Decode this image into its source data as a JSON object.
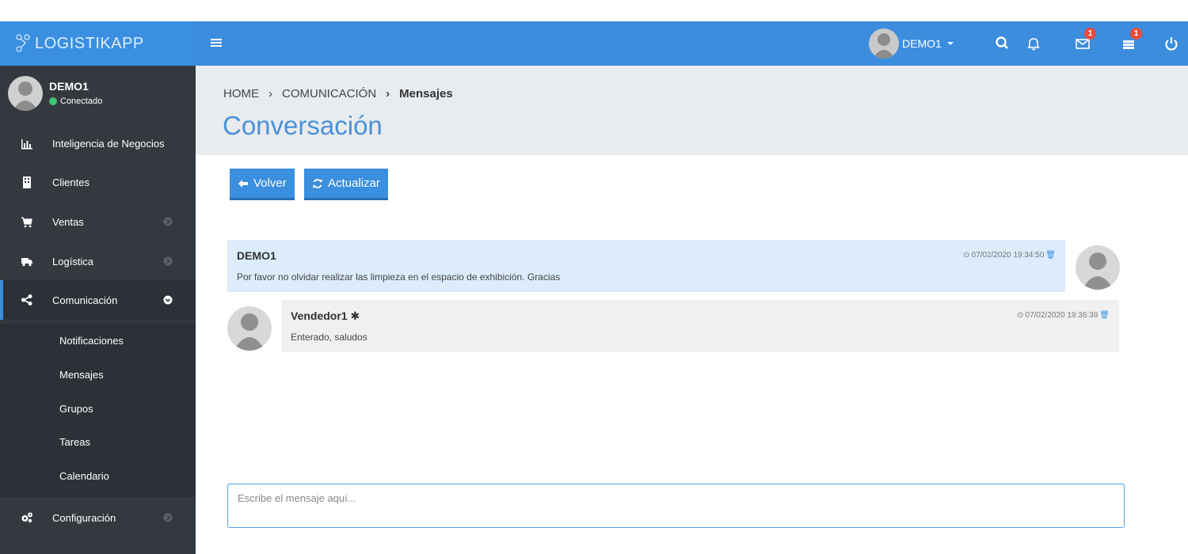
{
  "app": {
    "logo_text": "LOGISTIKAPP"
  },
  "topbar": {
    "user_name": "DEMO1",
    "mail_badge": "1",
    "tasks_badge": "1"
  },
  "sidebar": {
    "user": {
      "name": "DEMO1",
      "status": "Conectado"
    },
    "items": [
      {
        "label": "Inteligencia de Negocios"
      },
      {
        "label": "Clientes"
      },
      {
        "label": "Ventas"
      },
      {
        "label": "Logística"
      },
      {
        "label": "Comunicación"
      },
      {
        "label": "Configuración"
      }
    ],
    "submenu": [
      {
        "label": "Notificaciones"
      },
      {
        "label": "Mensajes"
      },
      {
        "label": "Grupos"
      },
      {
        "label": "Tareas"
      },
      {
        "label": "Calendario"
      }
    ]
  },
  "breadcrumb": {
    "home": "HOME",
    "section": "COMUNICACIÓN",
    "current": "Mensajes"
  },
  "page": {
    "title": "Conversación",
    "back_label": "Volver",
    "refresh_label": "Actualizar"
  },
  "messages": [
    {
      "author": "DEMO1",
      "text": "Por favor no olvidar realizar las limpieza en el espacio de exhibición. Gracias",
      "time": "07/02/2020 19:34:50"
    },
    {
      "author": "Vendedor1",
      "text": "Enterado, saludos",
      "time": "07/02/2020 19:36:39"
    }
  ],
  "composer": {
    "placeholder": "Escribe el mensaje aquí..."
  },
  "colors": {
    "topbar": "#3c8dde",
    "sidebar": "#33393f",
    "accent": "#3a8fde",
    "online": "#3ec46d",
    "badge": "#e74c3c"
  }
}
